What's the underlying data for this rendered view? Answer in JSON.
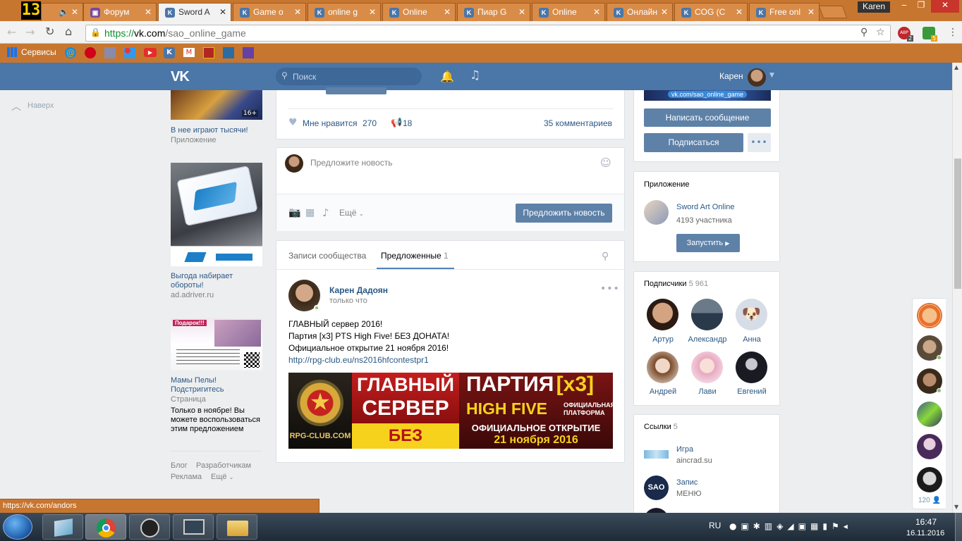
{
  "browser": {
    "tab_counter": "13",
    "tabs": [
      "Форум",
      "Sword A",
      "Game o",
      "online g",
      "Online",
      "Пиар G",
      "Online",
      "Онлайн",
      "COG (C",
      "Free onl"
    ],
    "user_name": "Karen",
    "url_scheme": "https://",
    "url_host": "vk.com",
    "url_path": "/sao_online_game",
    "bookmarks_label": "Сервисы",
    "ext_badge_1": "2",
    "ext_badge_2": "5",
    "status_url": "https://vk.com/andors"
  },
  "vk_header": {
    "logo": "VK",
    "search_placeholder": "Поиск",
    "user_name": "Карен"
  },
  "left": {
    "back_to_top": "Наверх"
  },
  "ads": [
    {
      "title": "В нее играют тысячи!",
      "sub": "Приложение",
      "age": "16+"
    },
    {
      "title": "Выгода набирает обороты!",
      "sub": "ad.adriver.ru"
    },
    {
      "title": "Мамы Пелы! Подстригитесь",
      "sub": "Страница",
      "body": "Только в ноябре! Вы можете воспользоваться этим предложением",
      "banner_title": "Подарок!!!"
    }
  ],
  "footer_links": [
    "Блог",
    "Разработчикам",
    "Реклама",
    "Ещё"
  ],
  "post_top": {
    "like_label": "Мне нравится",
    "like_count": "270",
    "share_count": "18",
    "comments": "35 комментариев"
  },
  "suggest": {
    "placeholder": "Предложите новость",
    "more": "Ещё",
    "button": "Предложить новость"
  },
  "wall_tabs": {
    "tab1": "Записи сообщества",
    "tab2": "Предложенные",
    "tab2_count": "1"
  },
  "post": {
    "author": "Карен Дадоян",
    "time": "только что",
    "line1": "ГЛАВНЫЙ сервер 2016!",
    "line2": "Партия [x3] PTS High Five! БЕЗ ДОНАТА!",
    "line3": "Официальное открытие 21 ноября 2016!",
    "link": "http://rpg-club.eu/ns2016hfcontestpr1",
    "banner": {
      "site": "RPG-CLUB.COM",
      "main1": "ГЛАВНЫЙ",
      "main2": "СЕРВЕР",
      "no_donate": "БЕЗ ДОНАТА",
      "party": "ПАРТИЯ",
      "x3": "[x3]",
      "hf": "HIGH FIVE",
      "platform1": "ОФИЦИАЛЬНАЯ",
      "platform2": "ПЛАТФОРМА",
      "opening": "ОФИЦИАЛЬНОЕ ОТКРЫТИЕ",
      "date": "21 ноября 2016"
    }
  },
  "right": {
    "cover_url": "vk.com/sao_online_game",
    "write_btn": "Написать сообщение",
    "subscribe_btn": "Подписаться",
    "app_header": "Приложение",
    "app_name": "Sword Art Online",
    "app_members": "4193 участника",
    "app_launch": "Запустить",
    "subs_header": "Подписчики",
    "subs_count": "5 961",
    "subscribers": [
      "Артур",
      "Александр",
      "Анна",
      "Андрей",
      "Лави",
      "Евгений"
    ],
    "links_header": "Ссылки",
    "links_count": "5",
    "links": [
      {
        "title": "Игра",
        "sub": "aincrad.su"
      },
      {
        "title": "Запис",
        "sub": "МЕНЮ",
        "icon": "SAO"
      }
    ]
  },
  "friends_bar": {
    "count": "120"
  },
  "taskbar": {
    "lang": "RU",
    "time": "16:47",
    "date": "16.11.2016"
  },
  "colors": {
    "vk_blue": "#4a76a8",
    "chrome_orange": "#c77630",
    "button_blue": "#5e81a8"
  }
}
